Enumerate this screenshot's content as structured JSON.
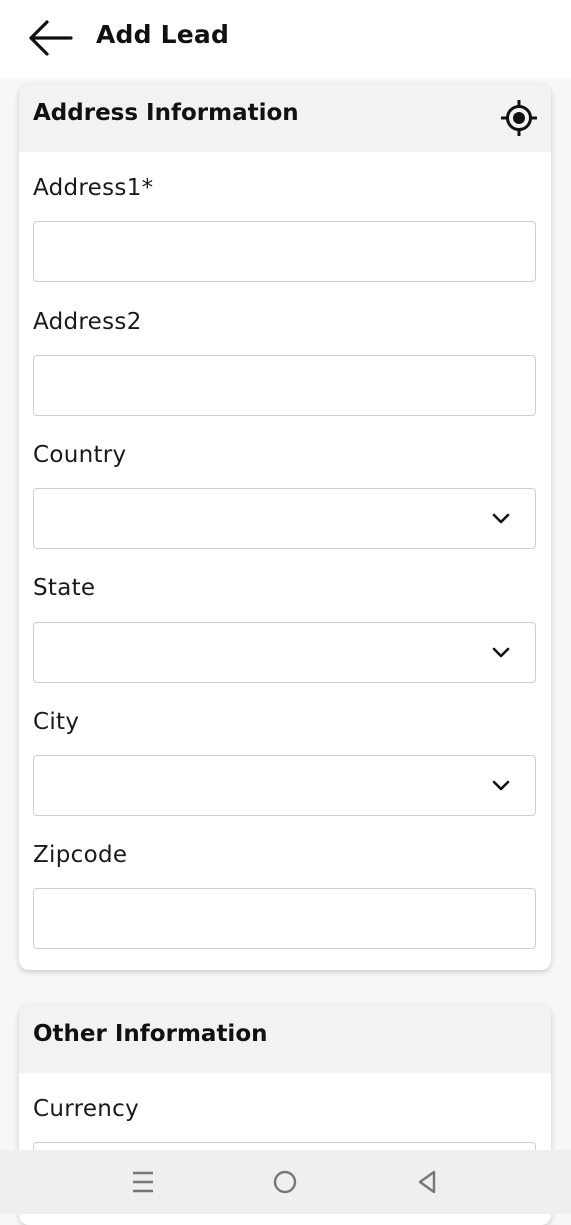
{
  "header": {
    "title": "Add Lead",
    "back_icon": "arrow-left-icon"
  },
  "address_section": {
    "title": "Address Information",
    "locate_icon": "gps-target-icon",
    "fields": {
      "address1": {
        "label": "Address1*",
        "value": "",
        "placeholder": ""
      },
      "address2": {
        "label": "Address2",
        "value": "",
        "placeholder": ""
      },
      "country": {
        "label": "Country",
        "selected": ""
      },
      "state": {
        "label": "State",
        "selected": ""
      },
      "city": {
        "label": "City",
        "selected": ""
      },
      "zipcode": {
        "label": "Zipcode",
        "value": "",
        "placeholder": ""
      }
    }
  },
  "other_section": {
    "title": "Other Information",
    "fields": {
      "currency": {
        "label": "Currency",
        "value": ""
      }
    }
  },
  "system_nav": {
    "recents_icon": "menu-lines-icon",
    "home_icon": "circle-home-icon",
    "back_icon": "triangle-back-icon"
  }
}
